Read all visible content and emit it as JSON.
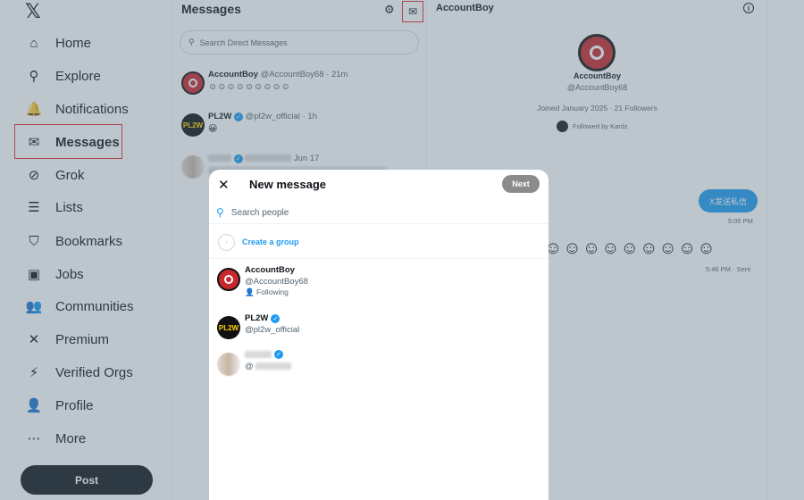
{
  "nav": {
    "logo": "𝕏",
    "items": [
      {
        "label": "Home",
        "icon": "home-icon",
        "glyph": "⌂"
      },
      {
        "label": "Explore",
        "icon": "search-icon",
        "glyph": "⚲"
      },
      {
        "label": "Notifications",
        "icon": "bell-icon",
        "glyph": "🔔"
      },
      {
        "label": "Messages",
        "icon": "envelope-icon",
        "glyph": "✉"
      },
      {
        "label": "Grok",
        "icon": "grok-icon",
        "glyph": "⊘"
      },
      {
        "label": "Lists",
        "icon": "list-icon",
        "glyph": "☰"
      },
      {
        "label": "Bookmarks",
        "icon": "bookmark-icon",
        "glyph": "⛉"
      },
      {
        "label": "Jobs",
        "icon": "briefcase-icon",
        "glyph": "▣"
      },
      {
        "label": "Communities",
        "icon": "communities-icon",
        "glyph": "👥"
      },
      {
        "label": "Premium",
        "icon": "x-premium-icon",
        "glyph": "✕"
      },
      {
        "label": "Verified Orgs",
        "icon": "lightning-icon",
        "glyph": "⚡"
      },
      {
        "label": "Profile",
        "icon": "person-icon",
        "glyph": "👤"
      },
      {
        "label": "More",
        "icon": "more-icon",
        "glyph": "⋯"
      }
    ],
    "post_label": "Post"
  },
  "messages": {
    "title": "Messages",
    "search_placeholder": "Search Direct Messages",
    "conversations": [
      {
        "name": "AccountBoy",
        "handle": "@AccountBoy68",
        "time": "21m",
        "preview": "☺☺☺☺☺☺☺☺☺"
      },
      {
        "name": "PL2W",
        "handle": "@pl2w_official",
        "time": "1h",
        "preview": "😀"
      },
      {
        "name": "",
        "handle": "",
        "time": "Jun 17",
        "preview": ""
      }
    ]
  },
  "chat": {
    "title": "AccountBoy",
    "profile_name": "AccountBoy",
    "profile_handle": "@AccountBoy68",
    "profile_meta": "Joined January 2025 · 21 Followers",
    "followed_by": "Followed by Kardz",
    "bubble_text": "X发送私信",
    "time1": "5:05 PM",
    "emoji_row": "☺☺☺☺☺☺☺☺☺",
    "time2": "5:46 PM · Sent"
  },
  "modal": {
    "title": "New message",
    "next_label": "Next",
    "search_placeholder": "Search people",
    "create_group_label": "Create a group",
    "people": [
      {
        "name": "AccountBoy",
        "handle": "@AccountBoy68",
        "relation": "Following",
        "verified": false
      },
      {
        "name": "PL2W",
        "handle": "@pl2w_official",
        "relation": "",
        "verified": true
      },
      {
        "name": "",
        "handle": "@",
        "relation": "",
        "verified": true
      }
    ]
  },
  "colors": {
    "accent": "#1d9bf0",
    "highlight": "#e0302b"
  }
}
